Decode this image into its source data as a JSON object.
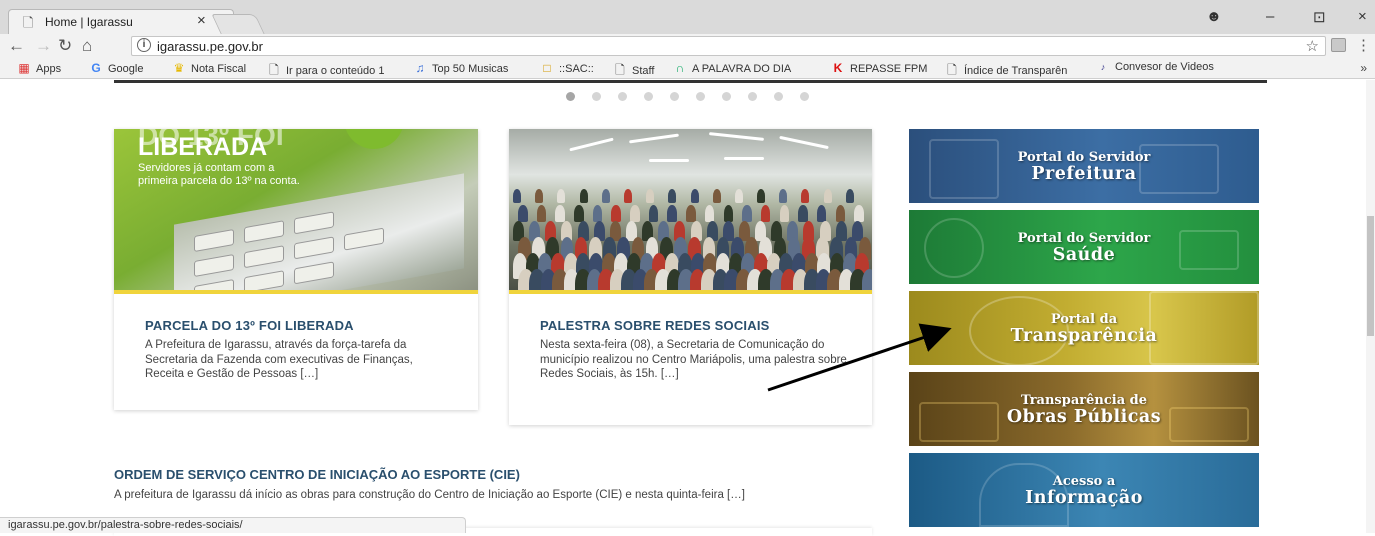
{
  "browser": {
    "tab_title": "Home | Igarassu",
    "tab_close": "×",
    "url": "igarassu.pe.gov.br",
    "window_controls": [
      "–",
      "⊡",
      "×"
    ],
    "account_icon": "account-circle-icon"
  },
  "bookmarks": [
    {
      "label": "Apps",
      "icon": "apps-grid-icon"
    },
    {
      "label": "Google",
      "icon": "google-icon"
    },
    {
      "label": "Nota Fiscal",
      "icon": "crown-icon"
    },
    {
      "label": "Ir para o conteúdo 1",
      "icon": "page-icon"
    },
    {
      "label": "Top 50 Musicas",
      "icon": "music-icon"
    },
    {
      "label": "::SAC::",
      "icon": "lock-icon"
    },
    {
      "label": "Staff",
      "icon": "page-icon"
    },
    {
      "label": "A PALAVRA DO DIA",
      "icon": "bracket-icon"
    },
    {
      "label": "REPASSE FPM",
      "icon": "k-icon"
    },
    {
      "label": "Índice de Transparên",
      "icon": "page-icon"
    },
    {
      "label": "Convesor de Videos",
      "icon": "mp3-icon"
    }
  ],
  "slider": {
    "dot_count": 10,
    "active_index": 0
  },
  "news": [
    {
      "image_headline_top": "DO 13º FOI",
      "image_headline": "LIBERADA",
      "image_caption": "Servidores já contam com a primeira parcela do 13º na conta.",
      "title": "PARCELA DO 13º FOI LIBERADA",
      "excerpt": "A Prefeitura de Igarassu, através da força-tarefa da Secretaria da Fazenda com executivas de Finanças, Receita e Gestão de Pessoas […]"
    },
    {
      "title": "PALESTRA SOBRE REDES SOCIAIS",
      "excerpt": "Nesta sexta-feira (08), a Secretaria de Comunicação do município realizou no Centro Mariápolis, uma palestra sobre Redes Sociais, às 15h. […]"
    },
    {
      "title": "ORDEM DE SERVIÇO CENTRO DE INICIAÇÃO AO ESPORTE (CIE)",
      "excerpt": "A prefeitura de Igarassu dá início as obras para construção do Centro de Iniciação ao Esporte (CIE) e nesta quinta-feira […]"
    }
  ],
  "portals": [
    {
      "line1": "Portal do Servidor",
      "line2": "Prefeitura"
    },
    {
      "line1": "Portal do Servidor",
      "line2": "Saúde"
    },
    {
      "line1": "Portal da",
      "line2": "Transparência"
    },
    {
      "line1": "Transparência de",
      "line2": "Obras Públicas"
    },
    {
      "line1": "Acesso a",
      "line2": "Informação"
    }
  ],
  "status_url": "igarassu.pe.gov.br/palestra-sobre-redes-sociais/",
  "colors": {
    "title_blue": "#2a4f6d",
    "accent_yellow": "#f0d43c"
  }
}
